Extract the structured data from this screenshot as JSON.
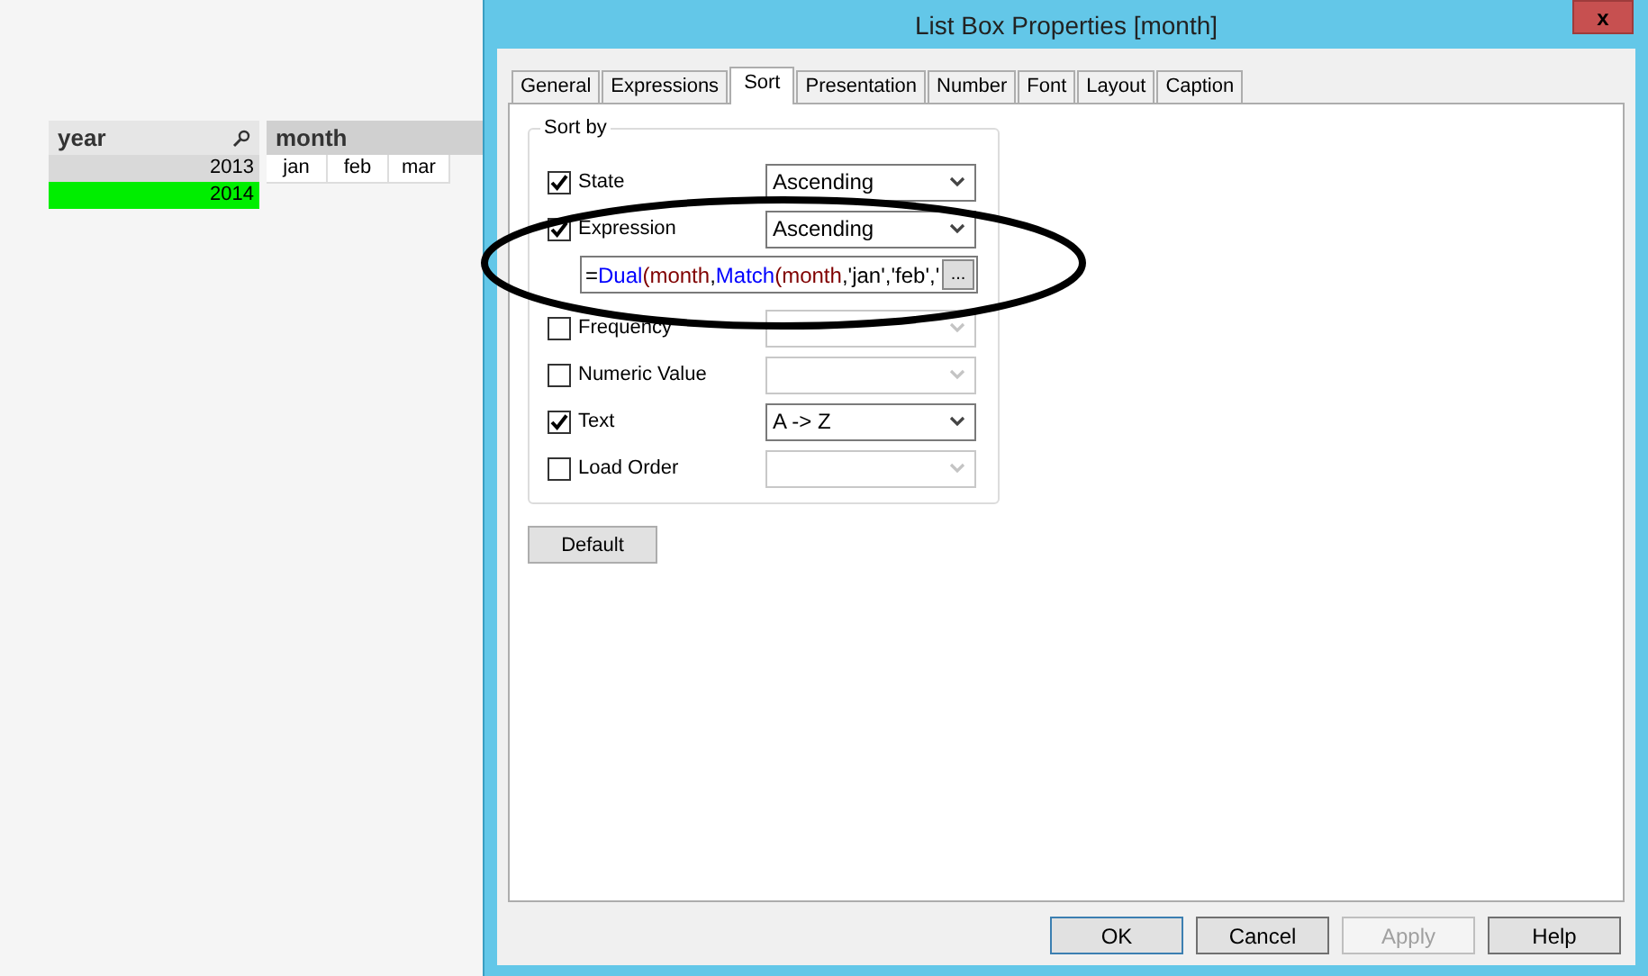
{
  "year_list": {
    "title": "year",
    "values": [
      {
        "label": "2013",
        "selected": false
      },
      {
        "label": "2014",
        "selected": true
      }
    ]
  },
  "month_list": {
    "title": "month",
    "values": [
      "jan",
      "feb",
      "mar"
    ]
  },
  "dialog": {
    "title": "List Box Properties [month]",
    "close": "x",
    "tabs": [
      {
        "label": "General",
        "selected": false
      },
      {
        "label": "Expressions",
        "selected": false
      },
      {
        "label": "Sort",
        "selected": true
      },
      {
        "label": "Presentation",
        "selected": false
      },
      {
        "label": "Number",
        "selected": false
      },
      {
        "label": "Font",
        "selected": false
      },
      {
        "label": "Layout",
        "selected": false
      },
      {
        "label": "Caption",
        "selected": false
      }
    ],
    "sort_group": {
      "title": "Sort by",
      "rows": [
        {
          "label": "State",
          "checked": true,
          "value": "Ascending",
          "disabled": false
        },
        {
          "label": "Expression",
          "checked": true,
          "value": "Ascending",
          "disabled": false,
          "expression": [
            {
              "kind": "operator",
              "text": "="
            },
            {
              "kind": "function",
              "text": "Dual"
            },
            {
              "kind": "field",
              "text": "(month"
            },
            {
              "kind": "operator",
              "text": ","
            },
            {
              "kind": "function",
              "text": "Match"
            },
            {
              "kind": "field",
              "text": "(month"
            },
            {
              "kind": "operator",
              "text": ",'jan','feb','"
            }
          ],
          "expression_button": "..."
        },
        {
          "label": "Frequency",
          "checked": false,
          "disabled": true
        },
        {
          "label": "Numeric Value",
          "checked": false,
          "disabled": true
        },
        {
          "label": "Text",
          "checked": true,
          "value": "A -> Z",
          "disabled": false
        },
        {
          "label": "Load Order",
          "checked": false,
          "disabled": true
        }
      ]
    },
    "default_button": "Default",
    "buttons": [
      {
        "label": "OK",
        "kind": "default",
        "disabled": false
      },
      {
        "label": "Cancel",
        "kind": "normal",
        "disabled": false
      },
      {
        "label": "Apply",
        "kind": "normal",
        "disabled": true
      },
      {
        "label": "Help",
        "kind": "normal",
        "disabled": false
      }
    ]
  }
}
